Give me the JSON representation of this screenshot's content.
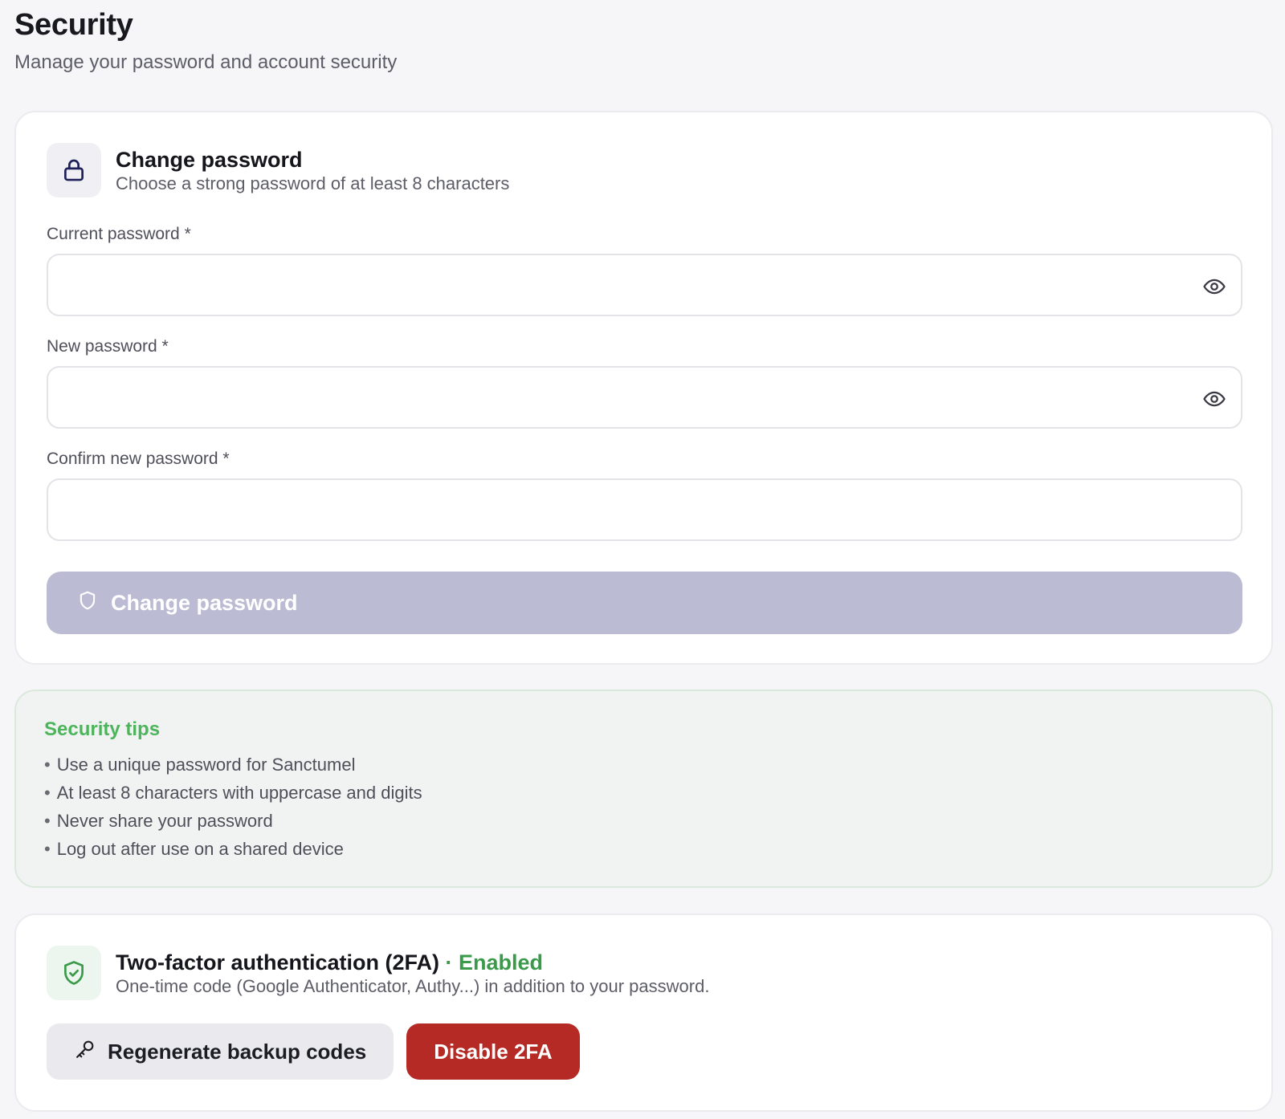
{
  "header": {
    "title": "Security",
    "subtitle": "Manage your password and account security"
  },
  "change_password": {
    "icon": "lock-icon",
    "title": "Change password",
    "description": "Choose a strong password of at least 8 characters",
    "fields": [
      {
        "label": "Current password *",
        "value": "",
        "placeholder": "",
        "toggle_icon": "eye-icon"
      },
      {
        "label": "New password *",
        "value": "",
        "placeholder": "",
        "toggle_icon": "eye-icon"
      },
      {
        "label": "Confirm new password *",
        "value": "",
        "placeholder": ""
      }
    ],
    "submit_label": "Change password",
    "submit_icon": "shield-icon"
  },
  "tips": {
    "title": "Security tips",
    "items": [
      "Use a unique password for Sanctumel",
      "At least 8 characters with uppercase and digits",
      "Never share your password",
      "Log out after use on a shared device"
    ]
  },
  "two_factor": {
    "icon": "shield-check-icon",
    "title": "Two-factor authentication (2FA)",
    "status": "· Enabled",
    "description": "One-time code (Google Authenticator, Authy...) in addition to your password.",
    "regenerate_label": "Regenerate backup codes",
    "regenerate_icon": "key-icon",
    "disable_label": "Disable 2FA"
  },
  "colors": {
    "accent": "#1e2157",
    "success": "#4cb55c",
    "danger": "#b52a24",
    "primary_disabled": "#bbbbd3"
  }
}
